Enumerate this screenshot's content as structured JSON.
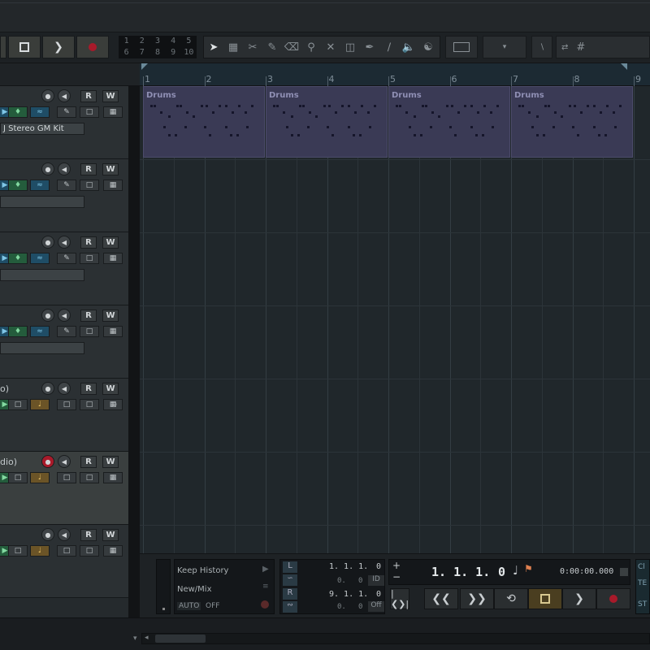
{
  "numpad": {
    "top": [
      "1",
      "2",
      "3",
      "4",
      "5"
    ],
    "bottom": [
      "6",
      "7",
      "8",
      "9",
      "10"
    ]
  },
  "ruler": {
    "bars": [
      "1",
      "2",
      "3",
      "4",
      "5",
      "6",
      "7",
      "8",
      "9"
    ]
  },
  "tracks": [
    {
      "name": "",
      "instrument": "J Stereo GM Kit"
    },
    {
      "name": "",
      "instrument": ""
    },
    {
      "name": "",
      "instrument": ""
    },
    {
      "name": "",
      "instrument": ""
    },
    {
      "name": "o)",
      "instrument": ""
    },
    {
      "name": "dio)",
      "instrument": ""
    },
    {
      "name": "",
      "instrument": ""
    }
  ],
  "buttons": {
    "read": "R",
    "write": "W"
  },
  "parts": [
    {
      "label": "Drums"
    },
    {
      "label": "Drums"
    },
    {
      "label": "Drums"
    },
    {
      "label": "Drums"
    }
  ],
  "transport": {
    "keep_history": "Keep History",
    "new_mix": "New/Mix",
    "auto": "AUTO",
    "auto_value": "OFF",
    "left_locator": "1. 1. 1.",
    "left_tick": "0",
    "left_sub": "0.",
    "left_sub2": "0",
    "left_badge": "ID",
    "right_locator": "9. 1. 1.",
    "right_tick": "0",
    "right_sub": "0.",
    "right_sub2": "0",
    "right_badge": "Off",
    "position": "1. 1. 1.",
    "position_tick": "0",
    "time": "0:00:00.000",
    "plus": "+",
    "minus": "−",
    "far_right_1": "Cl",
    "far_right_2": "TE",
    "far_right_3": "ST"
  },
  "colors": {
    "accent_blue": "#1f4d66",
    "accent_green": "#245c3c",
    "accent_orange": "#6b5427",
    "part_purple": "#3a3a55",
    "record_red": "#a81a2a"
  }
}
